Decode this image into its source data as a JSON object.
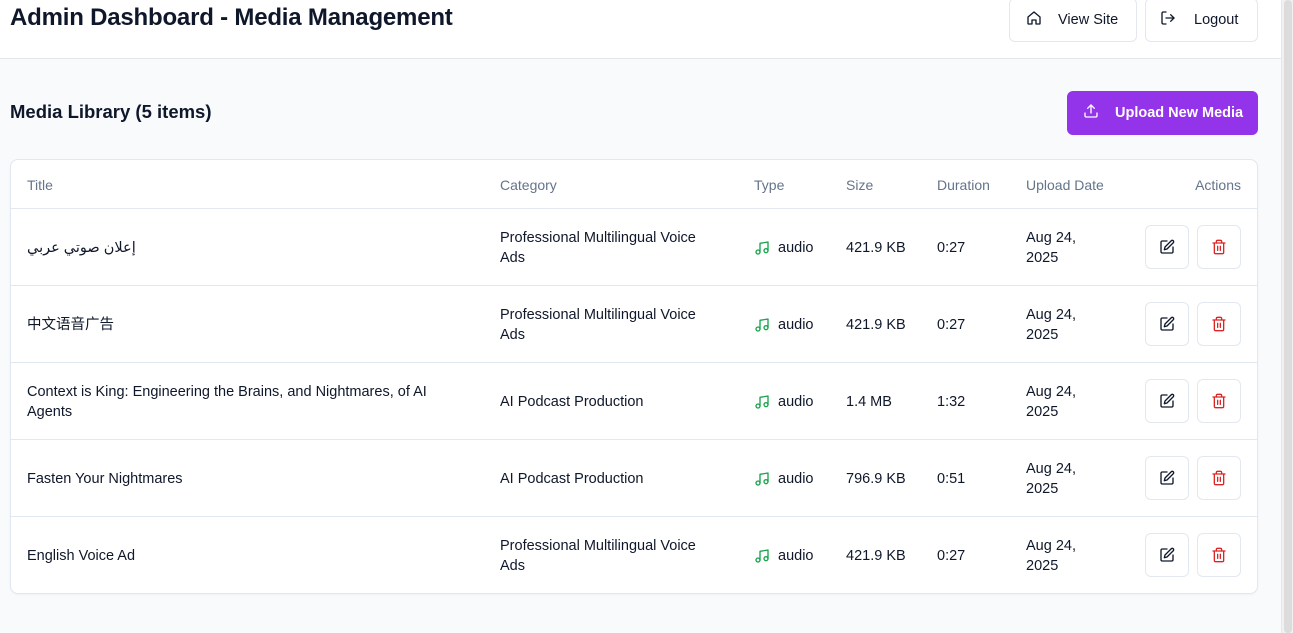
{
  "header": {
    "title": "Admin Dashboard - Media Management",
    "view_site_label": "View Site",
    "logout_label": "Logout"
  },
  "library": {
    "heading": "Media Library (5 items)",
    "upload_label": "Upload New Media"
  },
  "colors": {
    "accent": "#9333ea",
    "audio_icon": "#16a34a",
    "delete_icon": "#dc2626"
  },
  "table": {
    "columns": [
      "Title",
      "Category",
      "Type",
      "Size",
      "Duration",
      "Upload Date",
      "Actions"
    ],
    "rows": [
      {
        "title": "إعلان صوتي عربي",
        "category": "Professional Multilingual Voice Ads",
        "type": "audio",
        "size": "421.9 KB",
        "duration": "0:27",
        "date": "Aug 24, 2025"
      },
      {
        "title": "中文语音广告",
        "category": "Professional Multilingual Voice Ads",
        "type": "audio",
        "size": "421.9 KB",
        "duration": "0:27",
        "date": "Aug 24, 2025"
      },
      {
        "title": "Context is King: Engineering the Brains, and Nightmares, of AI Agents",
        "category": "AI Podcast Production",
        "type": "audio",
        "size": "1.4 MB",
        "duration": "1:32",
        "date": "Aug 24, 2025"
      },
      {
        "title": "Fasten Your Nightmares",
        "category": "AI Podcast Production",
        "type": "audio",
        "size": "796.9 KB",
        "duration": "0:51",
        "date": "Aug 24, 2025"
      },
      {
        "title": "English Voice Ad",
        "category": "Professional Multilingual Voice Ads",
        "type": "audio",
        "size": "421.9 KB",
        "duration": "0:27",
        "date": "Aug 24, 2025"
      }
    ]
  },
  "icons": {
    "view_site": "home-icon",
    "logout": "logout-icon",
    "upload": "upload-icon",
    "type": "music-note-icon",
    "edit": "edit-icon",
    "delete": "trash-icon"
  }
}
